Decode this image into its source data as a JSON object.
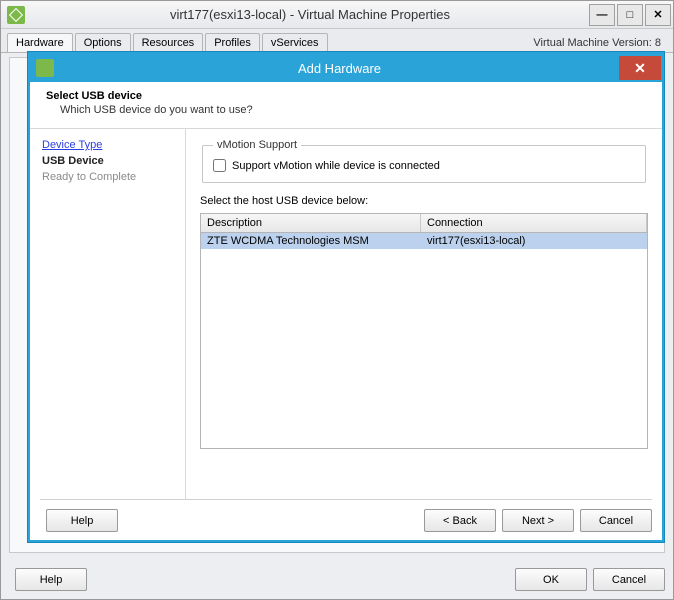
{
  "parent": {
    "title": "virt177(esxi13-local) - Virtual Machine Properties",
    "tabs": [
      "Hardware",
      "Options",
      "Resources",
      "Profiles",
      "vServices"
    ],
    "active_tab_index": 0,
    "version_label": "Virtual Machine Version: 8",
    "help_label": "Help",
    "ok_label": "OK",
    "cancel_label": "Cancel"
  },
  "child": {
    "title": "Add Hardware",
    "heading": "Select USB device",
    "subheading": "Which USB device do you want to use?",
    "steps": {
      "device_type": "Device Type",
      "usb_device": "USB Device",
      "ready": "Ready to Complete"
    },
    "vmotion": {
      "legend": "vMotion Support",
      "checkbox_label": "Support vMotion while device is connected"
    },
    "list_label": "Select the host USB device below:",
    "columns": {
      "desc": "Description",
      "conn": "Connection"
    },
    "rows": [
      {
        "desc": "ZTE WCDMA Technologies MSM",
        "conn": "virt177(esxi13-local)"
      }
    ],
    "buttons": {
      "help": "Help",
      "back": "< Back",
      "next": "Next >",
      "cancel": "Cancel"
    }
  }
}
